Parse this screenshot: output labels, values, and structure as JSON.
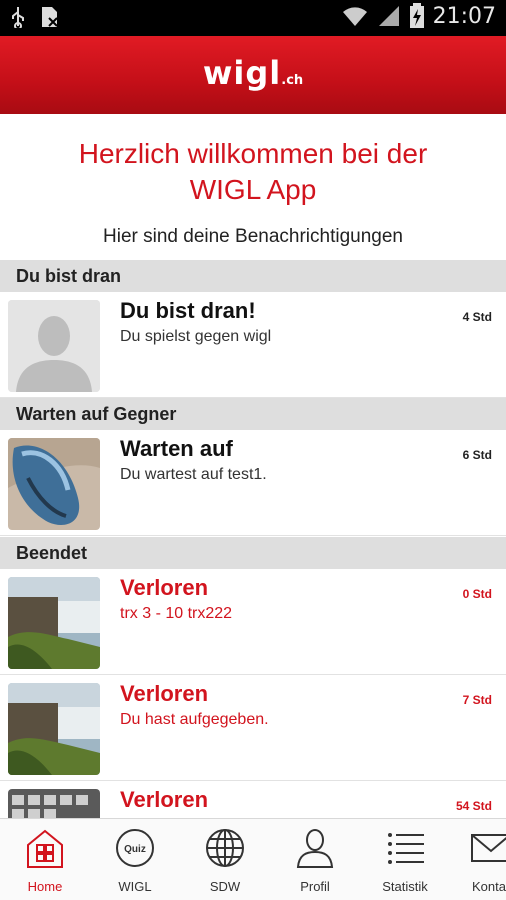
{
  "status_bar": {
    "time": "21:07",
    "icons": [
      "usb-icon",
      "sd-card-icon",
      "wifi-icon",
      "signal-icon",
      "battery-icon"
    ]
  },
  "header": {
    "logo_text": "wigl",
    "logo_tld": ".ch"
  },
  "welcome": {
    "title_line1": "Herzlich willkommen bei der",
    "title_line2": "WIGL App",
    "subtitle": "Hier sind deine Benachrichtigungen"
  },
  "sections": {
    "your_turn": "Du bist dran",
    "waiting": "Warten auf Gegner",
    "finished": "Beendet"
  },
  "notifications": [
    {
      "title": "Du bist dran!",
      "subtitle": "Du spielst gegen wigl",
      "time": "4 Std",
      "thumb": "default-avatar"
    },
    {
      "title": "Warten auf",
      "subtitle": "Du wartest auf test1.",
      "time": "6 Std",
      "thumb": "blue-mouse-photo"
    },
    {
      "title": "Verloren",
      "subtitle": "trx 3 - 10 trx222",
      "time": "0 Std",
      "thumb": "waterfall-photo"
    },
    {
      "title": "Verloren",
      "subtitle": "Du hast aufgegeben.",
      "time": "7 Std",
      "thumb": "waterfall-photo"
    },
    {
      "title": "Verloren",
      "subtitle": "",
      "time": "54 Std",
      "thumb": "keyboard-photo"
    }
  ],
  "bottom_nav": [
    {
      "label": "Home",
      "icon": "home-icon",
      "active": true
    },
    {
      "label": "WIGL",
      "icon": "quiz-icon",
      "active": false
    },
    {
      "label": "SDW",
      "icon": "globe-icon",
      "active": false
    },
    {
      "label": "Profil",
      "icon": "person-icon",
      "active": false
    },
    {
      "label": "Statistik",
      "icon": "list-icon",
      "active": false
    },
    {
      "label": "Kontakt",
      "icon": "mail-icon",
      "active": false
    }
  ],
  "colors": {
    "accent": "#d2141e",
    "header": "#c40f18",
    "section_bg": "#dedede"
  }
}
